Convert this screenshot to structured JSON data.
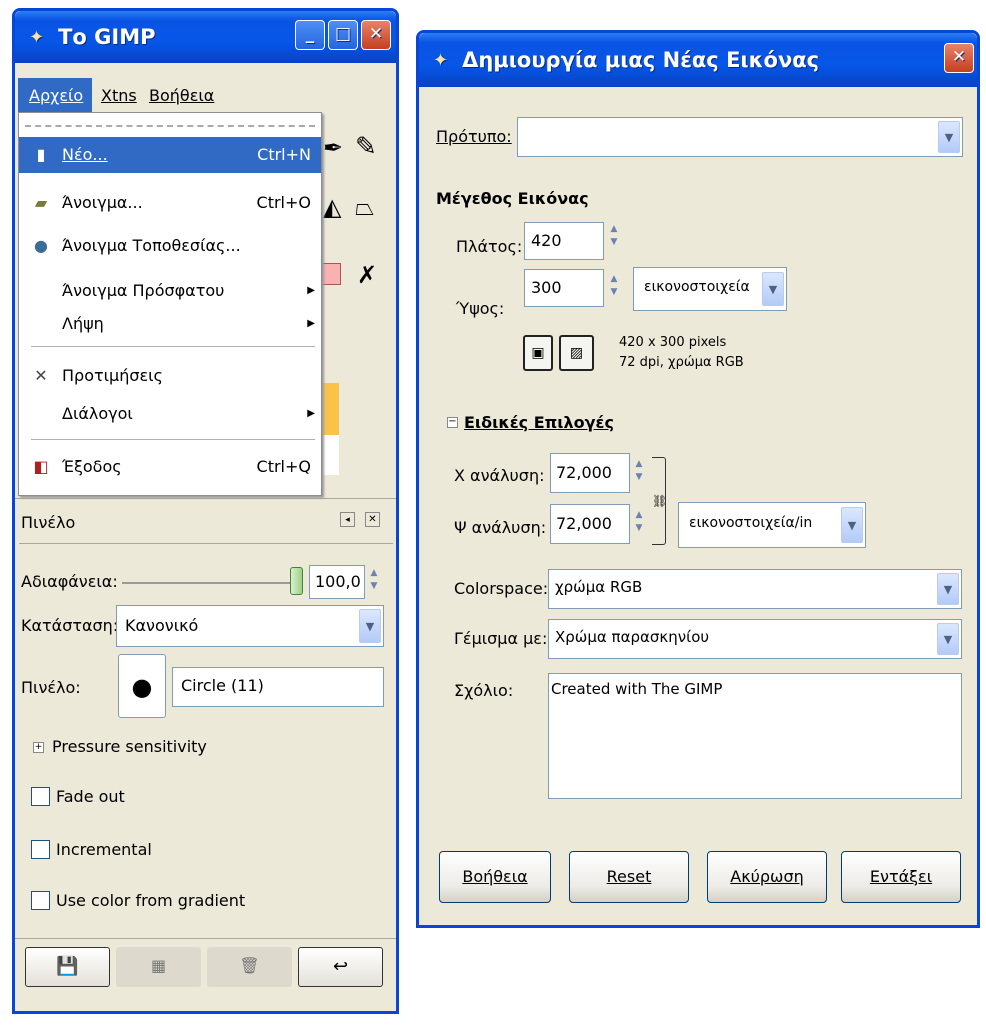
{
  "gimp": {
    "title": "Το GIMP",
    "menubar": [
      "Αρχείο",
      "Xtns",
      "Βοήθεια"
    ],
    "menu": [
      {
        "label": "Νέο...",
        "shortcut": "Ctrl+N",
        "icon": "new-document-icon",
        "glyph": "▮"
      },
      {
        "label": "Άνοιγμα...",
        "shortcut": "Ctrl+O",
        "icon": "open-folder-icon",
        "glyph": "▰"
      },
      {
        "label": "Άνοιγμα Τοποθεσίας...",
        "shortcut": "",
        "icon": "globe-icon",
        "glyph": "●"
      },
      {
        "label": "Άνοιγμα Πρόσφατου",
        "submenu": true
      },
      {
        "label": "Λήψη",
        "submenu": true
      },
      {
        "label": "Προτιμήσεις",
        "icon": "preferences-icon",
        "glyph": "✕"
      },
      {
        "label": "Διάλογοι",
        "submenu": true
      },
      {
        "label": "Έξοδος",
        "shortcut": "Ctrl+Q",
        "icon": "exit-icon",
        "glyph": "◧"
      }
    ],
    "brush_panel": {
      "title": "Πινέλο",
      "opacity_label": "Αδιαφάνεια:",
      "opacity_value": "100,0",
      "mode_label": "Κατάσταση:",
      "mode_value": "Κανονικό",
      "brush_label": "Πινέλο:",
      "brush_value": "Circle (11)",
      "pressure": "Pressure sensitivity",
      "fade": "Fade out",
      "incremental": "Incremental",
      "gradient": "Use color from gradient"
    }
  },
  "dialog": {
    "title": "Δημιουργία μιας Νέας Εικόνας",
    "template_label": "Πρότυπο:",
    "size_heading": "Μέγεθος Εικόνας",
    "width_label": "Πλάτος:",
    "width_value": "420",
    "height_label": "Ύψος:",
    "height_value": "300",
    "unit": "εικονοστοιχεία",
    "info1": "420 x 300 pixels",
    "info2": "72 dpi, χρώμα RGB",
    "advanced": "Ειδικές Επιλογές",
    "xres_label": "Χ ανάλυση:",
    "xres_value": "72,000",
    "yres_label": "Ψ ανάλυση:",
    "yres_value": "72,000",
    "res_unit": "εικονοστοιχεία/in",
    "colorspace_label": "Colorspace:",
    "colorspace_value": "χρώμα RGB",
    "fill_label": "Γέμισμα με:",
    "fill_value": "Χρώμα παρασκηνίου",
    "comment_label": "Σχόλιο:",
    "comment_value": "Created with The GIMP",
    "buttons": [
      "Βοήθεια",
      "Reset",
      "Ακύρωση",
      "Εντάξει"
    ]
  }
}
